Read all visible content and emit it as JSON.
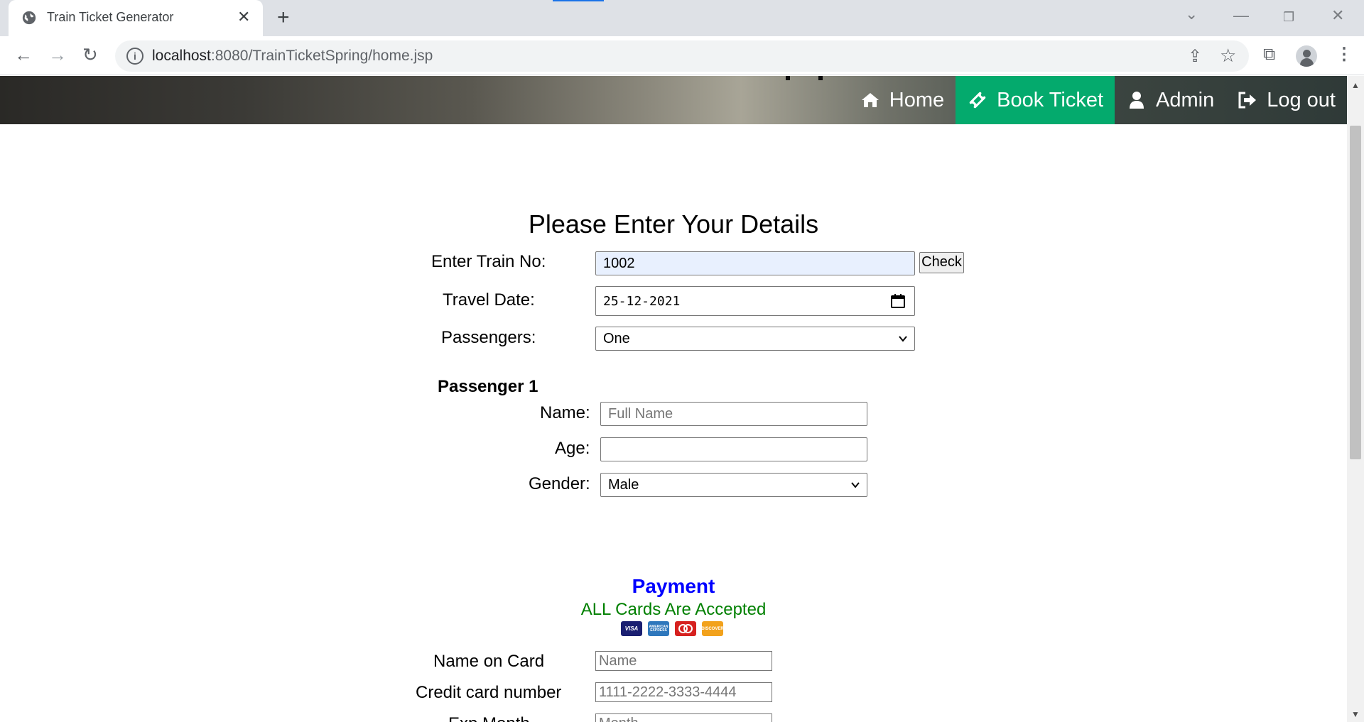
{
  "browser": {
    "tab_title": "Train Ticket Generator",
    "url_host": "localhost",
    "url_rest": ":8080/TrainTicketSpring/home.jsp"
  },
  "nav": {
    "home": "Home",
    "book": "Book Ticket",
    "admin": "Admin",
    "logout": "Log out",
    "active": "Book Ticket",
    "active_color": "#04aa6d"
  },
  "form": {
    "title": "Please Enter Your Details",
    "train_label": "Enter Train No:",
    "train_value": "1002",
    "check_button": "Check",
    "date_label": "Travel Date:",
    "date_value": "25-12-2021",
    "passengers_label": "Passengers:",
    "passengers_value": "One"
  },
  "passenger": {
    "heading": "Passenger 1",
    "name_label": "Name:",
    "name_placeholder": "Full Name",
    "age_label": "Age:",
    "gender_label": "Gender:",
    "gender_value": "Male"
  },
  "payment": {
    "title": "Payment",
    "subtitle": "ALL Cards Are Accepted",
    "title_color": "#0000ff",
    "subtitle_color": "#008000",
    "card_icons": [
      "visa-icon",
      "amex-icon",
      "mastercard-icon",
      "discover-icon"
    ],
    "visa_text": "VISA",
    "amex_text": "AMERICAN EXPRESS",
    "discover_text": "DISCOVER",
    "name_label": "Name on Card",
    "name_placeholder": "Name",
    "cc_label": "Credit card number",
    "cc_placeholder": "1111-2222-3333-4444",
    "exp_label": "Exp Month",
    "exp_placeholder": "Month"
  }
}
